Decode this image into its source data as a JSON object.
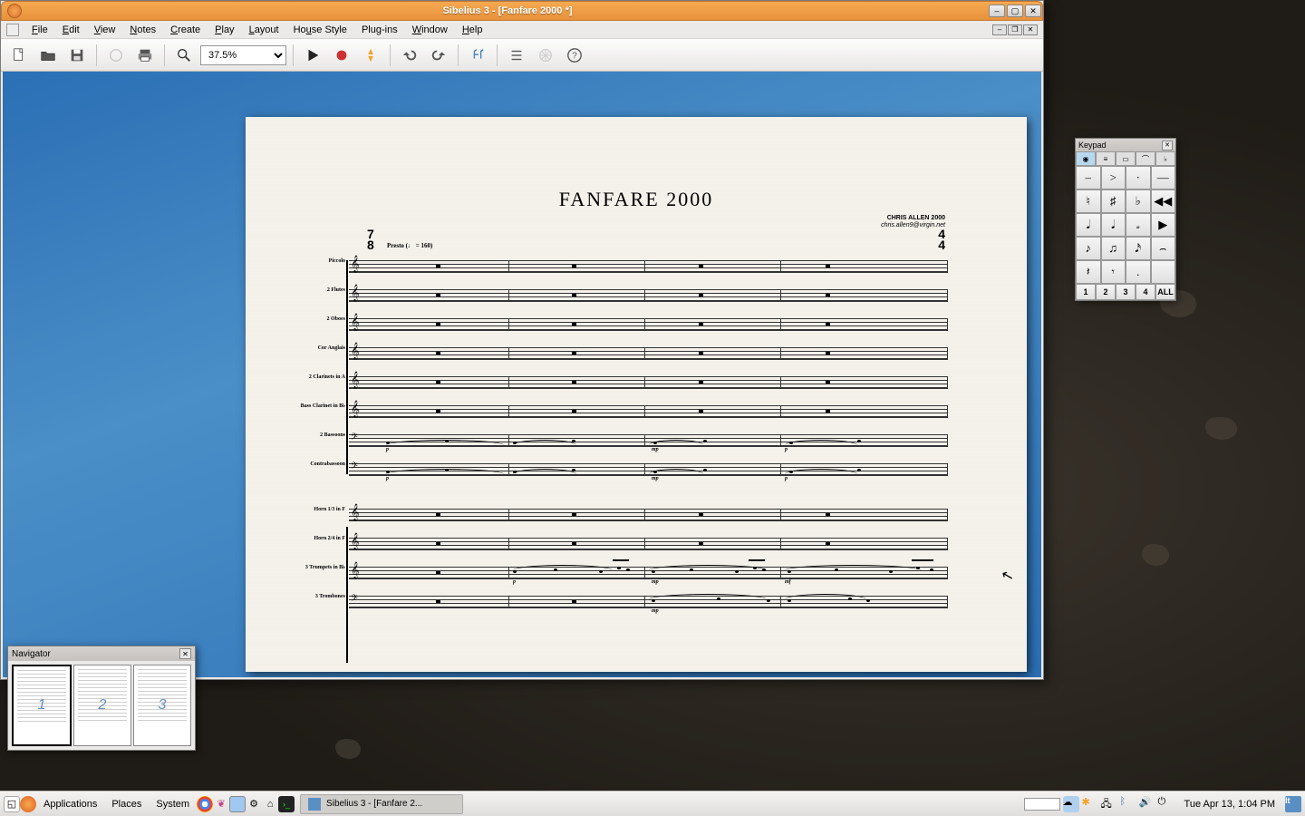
{
  "window": {
    "title": "Sibelius 3 - [Fanfare 2000 *]"
  },
  "menus": [
    "File",
    "Edit",
    "View",
    "Notes",
    "Create",
    "Play",
    "Layout",
    "House Style",
    "Plug-ins",
    "Window",
    "Help"
  ],
  "toolbar": {
    "zoom": "37.5%"
  },
  "score": {
    "title": "FANFARE 2000",
    "composer_line1": "CHRIS ALLEN  2000",
    "composer_line2": "chris.allen9@virgin.net",
    "time_sig_top": "7",
    "time_sig_bot": "8",
    "time_sig_end_top": "4",
    "time_sig_end_bot": "4",
    "tempo": "Presto  (♩ = 160)",
    "instruments": [
      "Piccolo",
      "2 Flutes",
      "2 Oboes",
      "Cor Anglais",
      "2 Clarinets in A",
      "Bass Clarinet in B♭",
      "2 Bassoons",
      "Contrabassoon",
      "Horn 1/3 in F",
      "Horn 2/4 in F",
      "3 Trumpets in B♭",
      "3 Trombones"
    ]
  },
  "navigator": {
    "title": "Navigator",
    "pages": [
      "1",
      "2",
      "3"
    ]
  },
  "keypad": {
    "title": "Keypad",
    "rows": [
      [
        "–",
        ">",
        "·",
        "—"
      ],
      [
        "♮",
        "♯",
        "♭",
        "◀◀"
      ],
      [
        "𝅘𝅥",
        "𝅘𝅥",
        "𝅗",
        "▶"
      ],
      [
        "♪",
        "♫",
        "𝅘𝅥𝅯",
        "⌢"
      ],
      [
        "𝄽",
        "𝄾",
        ".",
        "  "
      ]
    ],
    "footer": [
      "1",
      "2",
      "3",
      "4",
      "ALL"
    ]
  },
  "panel": {
    "menus": [
      "Applications",
      "Places",
      "System"
    ],
    "task": "Sibelius 3 - [Fanfare 2...",
    "clock": "Tue Apr 13,  1:04 PM"
  }
}
